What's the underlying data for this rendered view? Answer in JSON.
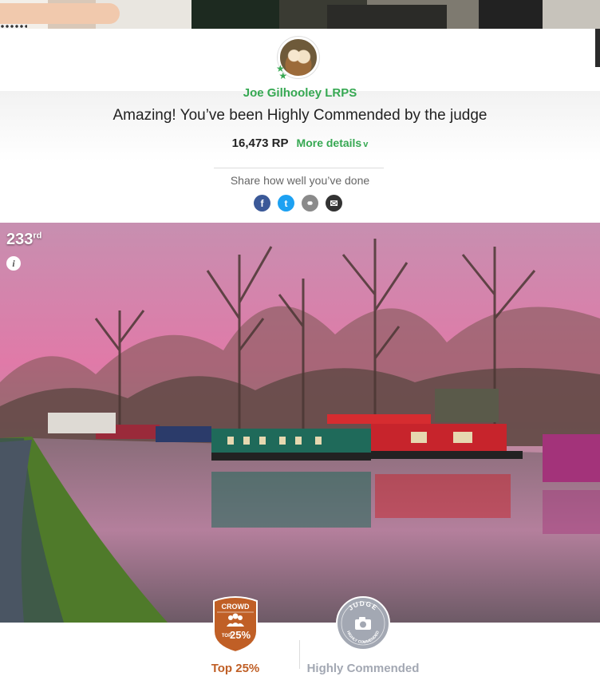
{
  "profile": {
    "username": "Joe Gilhooley LRPS"
  },
  "result": {
    "headline": "Amazing! You’ve been Highly Commended by the judge",
    "points": "16,473 RP",
    "more_details": "More details",
    "more_details_chevron": "v"
  },
  "share": {
    "label": "Share how well you’ve done",
    "icons": [
      "facebook-icon",
      "twitter-icon",
      "link-icon",
      "email-icon"
    ],
    "facebook_glyph": "f",
    "twitter_glyph": "t",
    "link_glyph": "⚭",
    "email_glyph": "✉"
  },
  "photo": {
    "rank_number": "233",
    "rank_suffix": "rd",
    "info_glyph": "i"
  },
  "badges": {
    "crowd": {
      "title": "CROWD",
      "top_prefix": "TOP",
      "percent": "25%",
      "label": "Top 25%",
      "color": "#c05f26"
    },
    "judge": {
      "title": "JUDGE",
      "arc_text": "HIGHLY COMMENDED",
      "label": "Highly Commended",
      "color": "#a3a8b3"
    }
  },
  "colors": {
    "accent_green": "#36a852",
    "facebook": "#3b5998",
    "twitter": "#1da1f2"
  }
}
